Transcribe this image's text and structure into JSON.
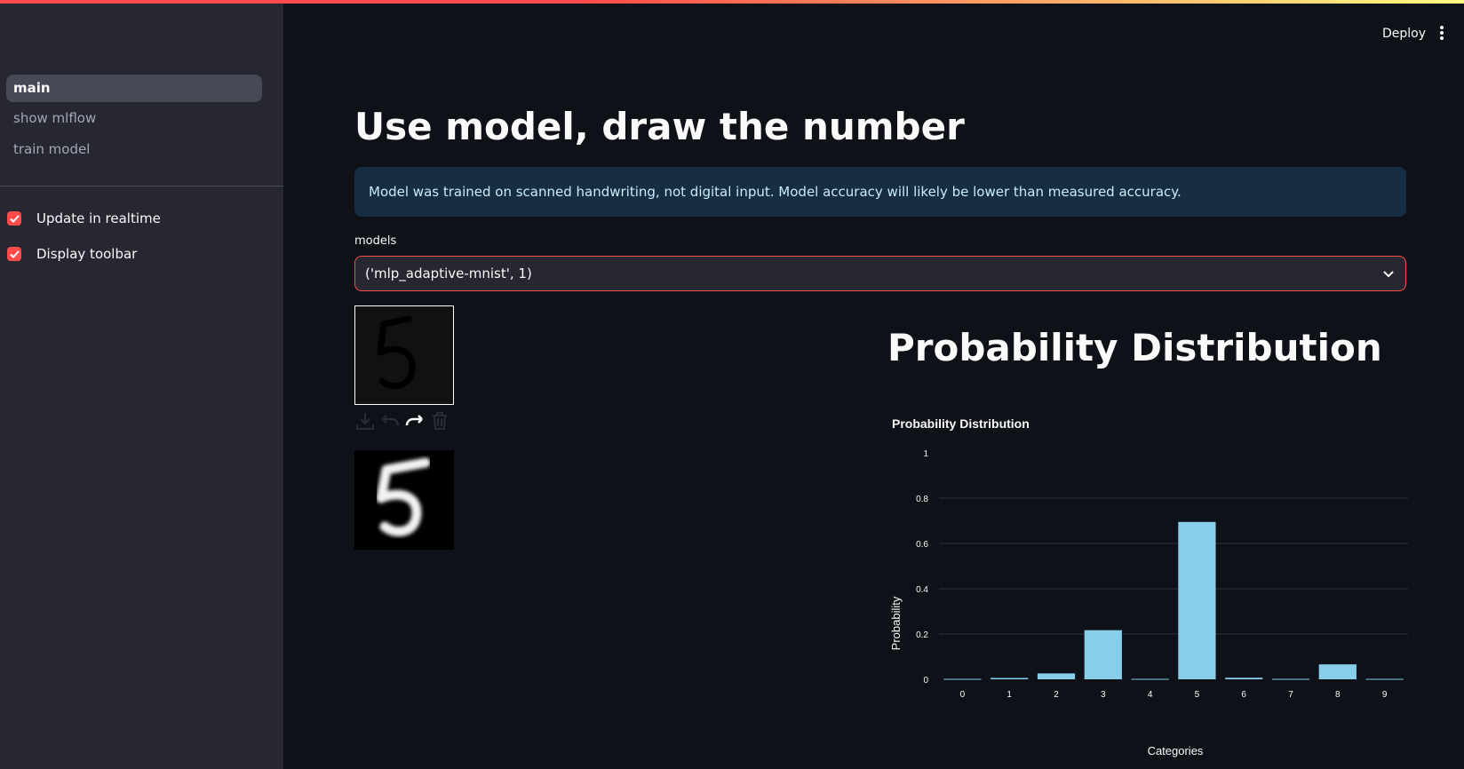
{
  "app": {
    "deploy_label": "Deploy",
    "menu_icon": "vertical-dots-icon"
  },
  "sidebar": {
    "nav": [
      {
        "label": "main",
        "active": true
      },
      {
        "label": "show mlflow",
        "active": false
      },
      {
        "label": "train model",
        "active": false
      }
    ],
    "checkboxes": [
      {
        "label": "Update in realtime",
        "checked": true
      },
      {
        "label": "Display toolbar",
        "checked": true
      }
    ]
  },
  "main": {
    "title": "Use model, draw the number",
    "info": "Model was trained on scanned handwriting, not digital input. Model accuracy will likely be lower than measured accuracy.",
    "models_label": "models",
    "models_value": "('mlp_adaptive-mnist', 1)",
    "toolbar_icons": [
      "download-icon",
      "undo-icon",
      "redo-icon",
      "trash-icon"
    ],
    "section_title": "Probability Distribution"
  },
  "colors": {
    "accent": "#ff4b4b",
    "bar": "#87ceeb",
    "info_bg": "#172d43",
    "sidebar_bg": "#262730",
    "bg": "#0e1117"
  },
  "chart_data": {
    "type": "bar",
    "title": "Probability Distribution",
    "xlabel": "Categories",
    "ylabel": "Probability",
    "categories": [
      "0",
      "1",
      "2",
      "3",
      "4",
      "5",
      "6",
      "7",
      "8",
      "9"
    ],
    "values": [
      0.002,
      0.006,
      0.026,
      0.217,
      0.002,
      0.695,
      0.007,
      0.002,
      0.066,
      0.002
    ],
    "ylim": [
      0,
      1
    ],
    "yticks": [
      "0",
      "0.2",
      "0.4",
      "0.6",
      "0.8",
      "1"
    ],
    "grid": true
  }
}
